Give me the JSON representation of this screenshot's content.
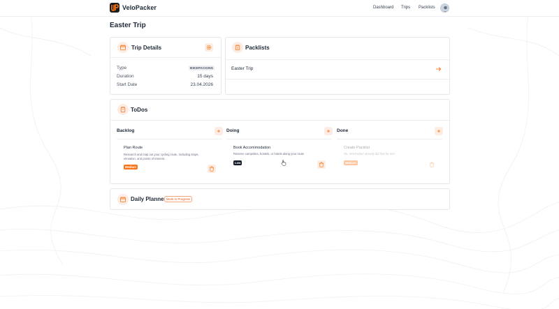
{
  "colors": {
    "accent": "#f97316",
    "accent_soft": "#fdece3",
    "dark": "#111827",
    "border": "#e5e7eb"
  },
  "header": {
    "brand": "VeloPacker",
    "nav": [
      "Dashboard",
      "Trips",
      "Packlists"
    ],
    "avatar_icon": "user-avatar"
  },
  "page": {
    "title": "Easter Trip"
  },
  "trip_details": {
    "title": "Trip Details",
    "icon": "calendar-icon",
    "settings_icon": "gear-icon",
    "rows": [
      {
        "label": "Type",
        "value": "BIKEPACKING"
      },
      {
        "label": "Duration",
        "value": "15 days"
      },
      {
        "label": "Start Date",
        "value": "23.04.2026"
      }
    ]
  },
  "packlists": {
    "title": "Packlists",
    "icon": "clipboard-icon",
    "items": [
      {
        "name": "Easter Trip",
        "icon": "arrow-right-icon"
      }
    ]
  },
  "todos": {
    "title": "ToDos",
    "icon": "clipboard-list-icon",
    "columns": [
      {
        "title": "Backlog",
        "cards": [
          {
            "title": "Plan Route",
            "desc_lines": [
              "Research and map out your cycling route, including stops,",
              "elevation, and points of interest."
            ],
            "priority": "Medium",
            "priority_color": "#f97316"
          }
        ]
      },
      {
        "title": "Doing",
        "cards": [
          {
            "title": "Book Accommodation",
            "desc_lines": [
              "Reserve campsites, hostels, or hotels along your route"
            ],
            "priority": "Low",
            "priority_color": "#111827"
          }
        ]
      },
      {
        "title": "Done",
        "cards": [
          {
            "title": "Create Packlist",
            "desc_lines": [
              "Ok, VeloPacker already did that for me!"
            ],
            "priority": "Medium",
            "priority_color": "#f97316"
          }
        ]
      }
    ]
  },
  "daily_planner": {
    "title": "Daily Planner",
    "badge": "Work in Progress",
    "icon": "calendar-icon"
  }
}
